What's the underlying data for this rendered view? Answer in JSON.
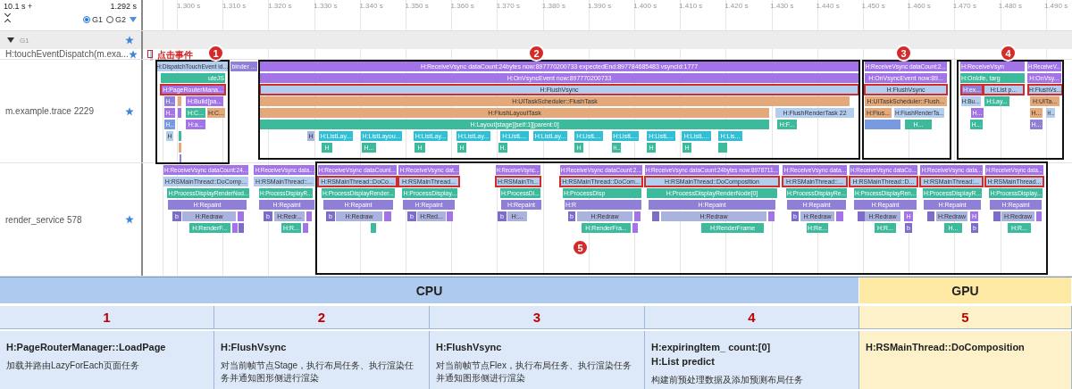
{
  "header": {
    "range_start": "10.1 s +",
    "range_end": "1.292 s",
    "views": [
      {
        "label": "G1",
        "selected": true
      },
      {
        "label": "G2",
        "selected": false
      }
    ]
  },
  "ruler": {
    "ticks": [
      "1.300 s",
      "1.310 s",
      "1.320 s",
      "1.330 s",
      "1.340 s",
      "1.350 s",
      "1.360 s",
      "1.370 s",
      "1.380 s",
      "1.390 s",
      "1.400 s",
      "1.410 s",
      "1.420 s",
      "1.430 s",
      "1.440 s",
      "1.450 s",
      "1.460 s",
      "1.470 s",
      "1.480 s",
      "1.490 s"
    ]
  },
  "group": {
    "label": "G1",
    "expanded": true,
    "starred": true
  },
  "tracks": [
    {
      "name": "H:touchEventDispatch(m.exa...",
      "starred": true,
      "annotation": "点击事件",
      "slices": [
        {
          "color": "#b3cdef"
        }
      ]
    },
    {
      "name": "m.example.trace 2229",
      "starred": true,
      "slices": [
        {
          "label": "H:DispatchTouchEvent id...",
          "color": "#b3cdef"
        },
        {
          "label": "binder ...",
          "color": "#8f7fd6"
        },
        {
          "label": "H:ReceiveVsync dataCount:24bytes now:897770200733 expectedEnd:897784685483 vsyncId:1777",
          "color": "#a374e8"
        },
        {
          "label": "H:ReceiveVsync dataCount:2...",
          "color": "#a374e8"
        },
        {
          "label": "H:ReceiveVsyn",
          "color": "#a374e8"
        },
        {
          "label": "H:ReceiveV...",
          "color": "#a374e8"
        },
        {
          "label": "uteJS",
          "color": "#3db99c"
        },
        {
          "label": "H:OnVsyncEvent now:897770200733",
          "color": "#a374e8"
        },
        {
          "label": "H:OnVsyncEvent now:89...",
          "color": "#a374e8"
        },
        {
          "label": "H:OnIdle, targ",
          "color": "#3db99c"
        },
        {
          "label": "H:OnVsy...",
          "color": "#a374e8"
        },
        {
          "label": "H:PageRouterMana...",
          "color": "#a374e8",
          "highlighted": true
        },
        {
          "label": "H:FlushVsync",
          "color": "#b3cdef",
          "highlighted": true
        },
        {
          "label": "H:FlushVsync",
          "color": "#b3cdef",
          "highlighted": true
        },
        {
          "label": "H:ex...",
          "color": "#8f7fd6",
          "highlighted": true
        },
        {
          "label": "H:List p...",
          "color": "#b3cdef",
          "highlighted": true
        },
        {
          "label": "H:FlushVs...",
          "color": "#b3cdef",
          "highlighted": true
        },
        {
          "label": "H...",
          "color": "#8f7fd6"
        },
        {
          "color": "#e4a97a"
        },
        {
          "label": "H:Build[pa...",
          "color": "#a374e8"
        },
        {
          "label": "H:UITaskScheduler::FlushTask",
          "color": "#e4a97a"
        },
        {
          "label": "H:UITaskScheduler::Flush...",
          "color": "#e4a97a"
        },
        {
          "label": "H:Bu...",
          "color": "#b3cdef"
        },
        {
          "label": "H:Lay...",
          "color": "#3db99c"
        },
        {
          "label": "H:UITa...",
          "color": "#e4a97a"
        },
        {
          "label": "H...",
          "color": "#a374e8"
        },
        {
          "color": "#a374e8"
        },
        {
          "label": "H:C...",
          "color": "#3db99c"
        },
        {
          "label": "H:C...",
          "color": "#e4a97a"
        },
        {
          "label": "H:FlushLayoutTask",
          "color": "#e4a97a"
        },
        {
          "label": "H:FlushRenderTask 22",
          "color": "#b3cdef"
        },
        {
          "label": "H:Flus...",
          "color": "#e4a97a"
        },
        {
          "label": "H:FlushRenderTa...",
          "color": "#b3cdef"
        },
        {
          "label": "H...",
          "color": "#a374e8"
        },
        {
          "label": "H...",
          "color": "#e4a97a"
        },
        {
          "label": "H...",
          "color": "#b3cdef"
        },
        {
          "label": "H...",
          "color": "#7a9ae0"
        },
        {
          "label": "H:a...",
          "color": "#a374e8"
        },
        {
          "label": "H:Layout[stage][self:1][parent:0]",
          "color": "#3db99c"
        },
        {
          "label": "H:F...",
          "color": "#3db99c"
        },
        {
          "color": "#7a9ae0"
        },
        {
          "label": "H...",
          "color": "#3db99c"
        },
        {
          "label": "H...",
          "color": "#3db99c"
        },
        {
          "label": "H...",
          "color": "#8f7fd6"
        },
        {
          "label": "H",
          "color": "#b3cdef"
        },
        {
          "label": "H",
          "color": "#a9b3de"
        },
        {
          "label": "H:ListLay...",
          "color": "#31bfd6"
        },
        {
          "label": "H:ListLayou...",
          "color": "#31bfd6"
        },
        {
          "label": "H:ListLay...",
          "color": "#31bfd6"
        },
        {
          "label": "H:ListLay...",
          "color": "#31bfd6"
        },
        {
          "label": "H:ListL...",
          "color": "#31bfd6"
        },
        {
          "label": "H:ListLay...",
          "color": "#31bfd6"
        },
        {
          "label": "H:ListL...",
          "color": "#31bfd6"
        },
        {
          "label": "H:ListL...",
          "color": "#31bfd6"
        },
        {
          "label": "H:ListL...",
          "color": "#31bfd6"
        },
        {
          "label": "H:ListL...",
          "color": "#31bfd6"
        },
        {
          "label": "H:Lis...",
          "color": "#31bfd6"
        },
        {
          "label": "H",
          "color": "#3db99c"
        },
        {
          "label": "H...",
          "color": "#3db99c"
        },
        {
          "label": "H",
          "color": "#3db99c"
        },
        {
          "label": "H",
          "color": "#3db99c"
        },
        {
          "label": "H.",
          "color": "#3db99c"
        },
        {
          "label": "H",
          "color": "#3db99c"
        },
        {
          "label": "H...",
          "color": "#3db99c"
        },
        {
          "label": "H",
          "color": "#3db99c"
        },
        {
          "label": "H",
          "color": "#3db99c"
        },
        {
          "color": "#3db99c"
        },
        {
          "color": "#3db99c"
        },
        {
          "color": "#e4a97a"
        },
        {
          "color": "#8f7fd6"
        }
      ]
    },
    {
      "name": "render_service 578",
      "starred": true,
      "slices": [
        {
          "label": "H:ReceiveVsync dataCount:24...",
          "color": "#a374e8"
        },
        {
          "label": "H:ReceiveVsync data...",
          "color": "#a374e8"
        },
        {
          "label": "H:ReceiveVsync dataCount...",
          "color": "#a374e8"
        },
        {
          "label": "H:ReceiveVsync dat...",
          "color": "#a374e8"
        },
        {
          "label": "H:ReceiveVsync...",
          "color": "#a374e8"
        },
        {
          "label": "H:ReceiveVsync dataCount:2...",
          "color": "#a374e8"
        },
        {
          "label": "H:ReceiveVsync dataCount:24bytes now:8978711...",
          "color": "#a374e8"
        },
        {
          "label": "H:ReceiveVsync data...",
          "color": "#a374e8"
        },
        {
          "label": "H:ReceiveVsync dataCo...",
          "color": "#a374e8"
        },
        {
          "label": "H:ReceiveVsync data...",
          "color": "#a374e8"
        },
        {
          "label": "H:ReceiveVsync data...",
          "color": "#a374e8"
        },
        {
          "label": "H:RSMainThread::DoComp...",
          "color": "#b3cdef"
        },
        {
          "label": "H:RSMainThread::...",
          "color": "#b3cdef"
        },
        {
          "label": "H:RSMainThread::DoCo...",
          "color": "#b3cdef",
          "highlighted": true
        },
        {
          "label": "H:RSMainThread...",
          "color": "#b3cdef",
          "highlighted": true
        },
        {
          "label": "H:RSMainTh...",
          "color": "#b3cdef",
          "highlighted": true
        },
        {
          "label": "H:RSMainThread::DoCom...",
          "color": "#b3cdef",
          "highlighted": true
        },
        {
          "label": "H:RSMainThread::DoComposition",
          "color": "#b3cdef",
          "highlighted": true
        },
        {
          "label": "H:RSMainThread::...",
          "color": "#b3cdef",
          "highlighted": true
        },
        {
          "label": "H:RSMainThread::D...",
          "color": "#b3cdef",
          "highlighted": true
        },
        {
          "label": "H:RSMainThread:...",
          "color": "#b3cdef",
          "highlighted": true
        },
        {
          "label": "H:RSMainThread...",
          "color": "#b3cdef",
          "highlighted": true
        },
        {
          "label": "H:ProcessDisplayRenderNod...",
          "color": "#3db99c"
        },
        {
          "label": "H:ProcessDisplayR...",
          "color": "#3db99c"
        },
        {
          "label": "H:ProcessDisplayRender...",
          "color": "#3db99c"
        },
        {
          "label": "H:ProcessDisplay...",
          "color": "#3db99c"
        },
        {
          "label": "H:ProcessDi...",
          "color": "#3db99c"
        },
        {
          "label": "H:ProcessDisp",
          "color": "#3db99c"
        },
        {
          "label": "H:ProcessDisplayRenderNode[0]",
          "color": "#3db99c"
        },
        {
          "label": "H:ProcessDisplayRe...",
          "color": "#3db99c"
        },
        {
          "label": "H:ProcessDisplayRen...",
          "color": "#3db99c"
        },
        {
          "label": "H:ProcessDisplayR...",
          "color": "#3db99c"
        },
        {
          "label": "H:ProcessDisplay...",
          "color": "#3db99c"
        },
        {
          "label": "H:Repaint",
          "color": "#8f7fd6"
        },
        {
          "label": "H:Repaint",
          "color": "#8f7fd6"
        },
        {
          "label": "H:Repaint",
          "color": "#8f7fd6"
        },
        {
          "label": "H:Repaint",
          "color": "#8f7fd6"
        },
        {
          "label": "H:Repaint",
          "color": "#8f7fd6"
        },
        {
          "label": "H:R",
          "color": "#8f7fd6"
        },
        {
          "label": "H:Repaint",
          "color": "#8f7fd6"
        },
        {
          "label": "H:Repaint",
          "color": "#8f7fd6"
        },
        {
          "label": "H:Repaint",
          "color": "#8f7fd6"
        },
        {
          "label": "H:Repaint",
          "color": "#8f7fd6"
        },
        {
          "label": "H:Repaint",
          "color": "#8f7fd6"
        },
        {
          "label": "b",
          "color": "#7d6cc9"
        },
        {
          "label": "H:Redraw",
          "color": "#a9b3de"
        },
        {
          "color": "#a374e8"
        },
        {
          "label": "b",
          "color": "#7d6cc9"
        },
        {
          "label": "H:Redr...",
          "color": "#a9b3de"
        },
        {
          "color": "#a374e8"
        },
        {
          "label": "b",
          "color": "#7d6cc9"
        },
        {
          "label": "H:Redraw",
          "color": "#a9b3de"
        },
        {
          "color": "#a374e8"
        },
        {
          "label": "b",
          "color": "#7d6cc9"
        },
        {
          "label": "H:Red...",
          "color": "#a9b3de"
        },
        {
          "color": "#a374e8"
        },
        {
          "label": "b",
          "color": "#7d6cc9"
        },
        {
          "label": "H:...",
          "color": "#a9b3de"
        },
        {
          "label": "b",
          "color": "#7d6cc9"
        },
        {
          "label": "H:Redraw",
          "color": "#a9b3de"
        },
        {
          "color": "#a374e8"
        },
        {
          "color": "#7d6cc9"
        },
        {
          "label": "H:Redraw",
          "color": "#a9b3de"
        },
        {
          "color": "#a374e8"
        },
        {
          "label": "b",
          "color": "#7d6cc9"
        },
        {
          "label": "H:Redraw",
          "color": "#a9b3de"
        },
        {
          "color": "#a374e8"
        },
        {
          "color": "#7d6cc9"
        },
        {
          "label": "H:Redraw",
          "color": "#a9b3de"
        },
        {
          "label": "H",
          "color": "#a374e8"
        },
        {
          "color": "#7d6cc9"
        },
        {
          "label": "H:Redraw",
          "color": "#a9b3de"
        },
        {
          "label": "H",
          "color": "#a374e8"
        },
        {
          "color": "#7d6cc9"
        },
        {
          "label": "H:Redraw",
          "color": "#a9b3de"
        },
        {
          "color": "#a374e8"
        },
        {
          "label": "H:RenderF...",
          "color": "#3db99c"
        },
        {
          "color": "#a374e8"
        },
        {
          "color": "#7d6cc9"
        },
        {
          "label": "H:R...",
          "color": "#3db99c"
        },
        {
          "color": "#a374e8"
        },
        {
          "color": "#3db99c"
        },
        {
          "label": "H:RenderFra...",
          "color": "#3db99c"
        },
        {
          "color": "#a374e8"
        },
        {
          "label": "H:RenderFrame",
          "color": "#3db99c"
        },
        {
          "label": "H:Re...",
          "color": "#3db99c"
        },
        {
          "label": "H:R...",
          "color": "#3db99c"
        },
        {
          "label": "b",
          "color": "#7d6cc9"
        },
        {
          "label": "H...",
          "color": "#3db99c"
        },
        {
          "label": "b",
          "color": "#7d6cc9"
        },
        {
          "label": "H:R...",
          "color": "#3db99c"
        }
      ]
    }
  ],
  "callouts": [
    {
      "number": "1"
    },
    {
      "number": "2"
    },
    {
      "number": "3"
    },
    {
      "number": "4"
    },
    {
      "number": "5"
    }
  ],
  "table": {
    "groups": [
      {
        "label": "CPU",
        "kind": "cpu"
      },
      {
        "label": "GPU",
        "kind": "gpu"
      }
    ],
    "columns": [
      {
        "number": "1",
        "kind": "cpu",
        "titles": [
          "H:PageRouterManager::LoadPage"
        ],
        "description": "加载并路由LazyForEach页面任务"
      },
      {
        "number": "2",
        "kind": "cpu",
        "titles": [
          "H:FlushVsync"
        ],
        "description": "对当前帧节点Stage，执行布局任务、执行渲染任务并通知图形侧进行渲染"
      },
      {
        "number": "3",
        "kind": "cpu",
        "titles": [
          "H:FlushVsync"
        ],
        "description": "对当前帧节点Flex，执行布局任务、执行渲染任务并通知图形侧进行渲染"
      },
      {
        "number": "4",
        "kind": "cpu",
        "titles": [
          "H:expiringItem_ count:[0]",
          "H:List predict"
        ],
        "description": "构建前预处理数据及添加预测布局任务"
      },
      {
        "number": "5",
        "kind": "gpu",
        "titles": [
          "H:RSMainThread::DoComposition"
        ]
      }
    ]
  }
}
